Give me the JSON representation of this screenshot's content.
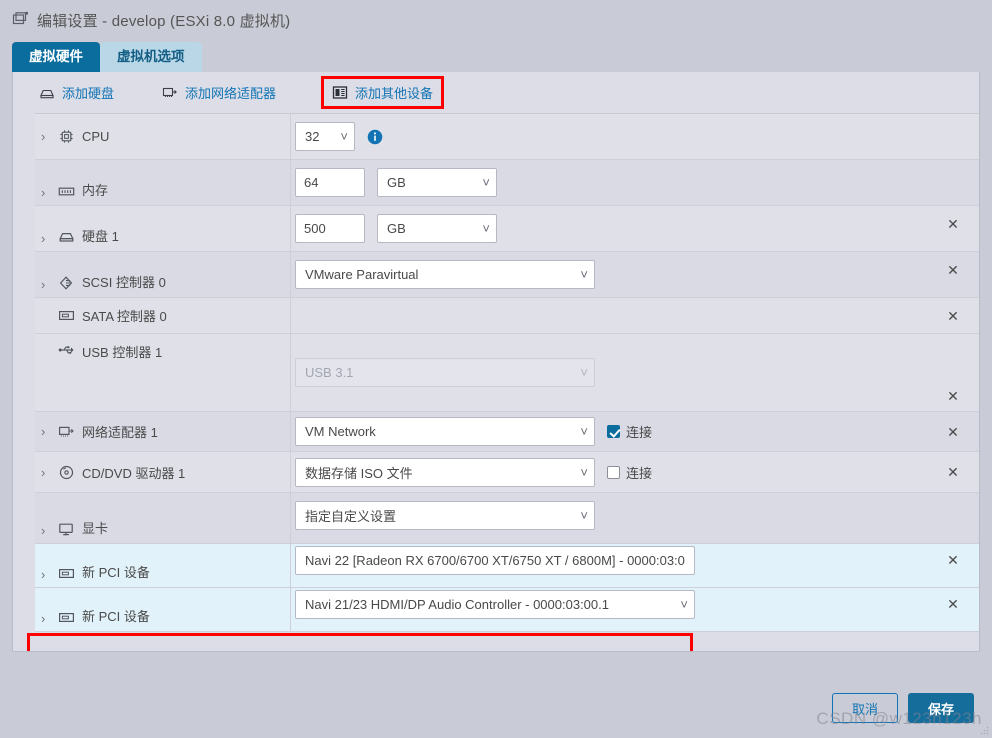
{
  "window": {
    "icon": "virtual-machine-icon",
    "title": "编辑设置 - develop (ESXi 8.0 虚拟机)"
  },
  "tabs": [
    {
      "label": "虚拟硬件",
      "active": true
    },
    {
      "label": "虚拟机选项",
      "active": false
    }
  ],
  "toolbar": {
    "add_hard_disk": "添加硬盘",
    "add_network_adapter": "添加网络适配器",
    "add_other_device": "添加其他设备"
  },
  "rows": [
    {
      "label": "CPU",
      "icon": "cpu-icon",
      "expandable": true,
      "value": "32",
      "control": "select",
      "removable": false
    },
    {
      "label": "内存",
      "icon": "memory-icon",
      "expandable": true,
      "value": "64",
      "unit": "GB",
      "control": "input-unit",
      "removable": false
    },
    {
      "label": "硬盘 1",
      "icon": "hard-disk-icon",
      "expandable": true,
      "value": "500",
      "unit": "GB",
      "control": "input-unit",
      "removable": true
    },
    {
      "label": "SCSI 控制器 0",
      "icon": "scsi-controller-icon",
      "expandable": true,
      "value": "VMware Paravirtual",
      "control": "select",
      "removable": true
    },
    {
      "label": "SATA 控制器 0",
      "icon": "sata-controller-icon",
      "expandable": false,
      "value": "",
      "control": "none",
      "removable": true
    },
    {
      "label": "USB 控制器 1",
      "icon": "usb-controller-icon",
      "expandable": false,
      "value": "USB 3.1",
      "control": "select-disabled",
      "removable": true
    },
    {
      "label": "网络适配器 1",
      "icon": "network-adapter-icon",
      "expandable": true,
      "value": "VM Network",
      "control": "select",
      "checkbox_label": "连接",
      "checked": true,
      "removable": true
    },
    {
      "label": "CD/DVD 驱动器 1",
      "icon": "cd-dvd-icon",
      "expandable": true,
      "value": "数据存储 ISO 文件",
      "control": "select",
      "checkbox_label": "连接",
      "checked": false,
      "removable": true
    },
    {
      "label": "显卡",
      "icon": "video-card-icon",
      "expandable": true,
      "value": "指定自定义设置",
      "control": "select",
      "removable": false
    },
    {
      "label": "新 PCI 设备",
      "icon": "pci-device-icon",
      "expandable": true,
      "value": "Navi 22 [Radeon RX 6700/6700 XT/6750 XT / 6800M] - 0000:03:0",
      "control": "select",
      "removable": true,
      "highlighted": true
    },
    {
      "label": "新 PCI 设备",
      "icon": "pci-device-icon",
      "expandable": true,
      "value": "Navi 21/23 HDMI/DP Audio Controller - 0000:03:00.1",
      "control": "select",
      "removable": true,
      "highlighted": true
    }
  ],
  "footer": {
    "cancel_label": "取消",
    "save_label": "保存"
  },
  "watermark": "CSDN @w123h123h",
  "colors": {
    "accent": "#0b6d9e",
    "link": "#1274b5",
    "highlight_outline": "#fe0000",
    "pci_row_bg": "#e2f2fa",
    "panel_bg": "#dcdde6",
    "window_bg": "#c9cbd6"
  }
}
